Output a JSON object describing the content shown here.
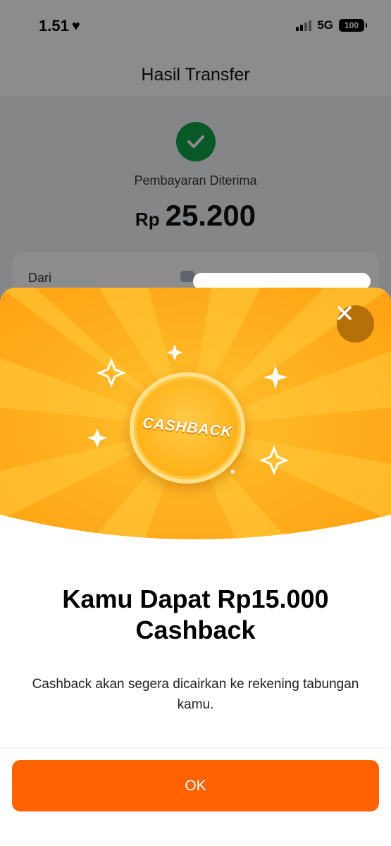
{
  "status_bar": {
    "time": "1.51",
    "heart_icon": "heart-icon",
    "network": "5G",
    "battery": "100"
  },
  "header": {
    "title": "Hasil Transfer"
  },
  "transfer": {
    "status_icon": "check-circle-icon",
    "status_text": "Pembayaran Diterima",
    "currency": "Rp",
    "amount": "25.200",
    "from_label": "Dari"
  },
  "cashback_sheet": {
    "close_icon": "close-icon",
    "coin_label": "CASHBACK",
    "title": "Kamu Dapat Rp15.000 Cashback",
    "description": "Cashback akan segera dicairkan ke rekening tabungan kamu.",
    "ok_label": "OK"
  },
  "colors": {
    "brand_orange": "#ff6200",
    "banner_orange": "#ffab1a",
    "success_green": "#12a04a",
    "close_bg": "#b67009"
  }
}
